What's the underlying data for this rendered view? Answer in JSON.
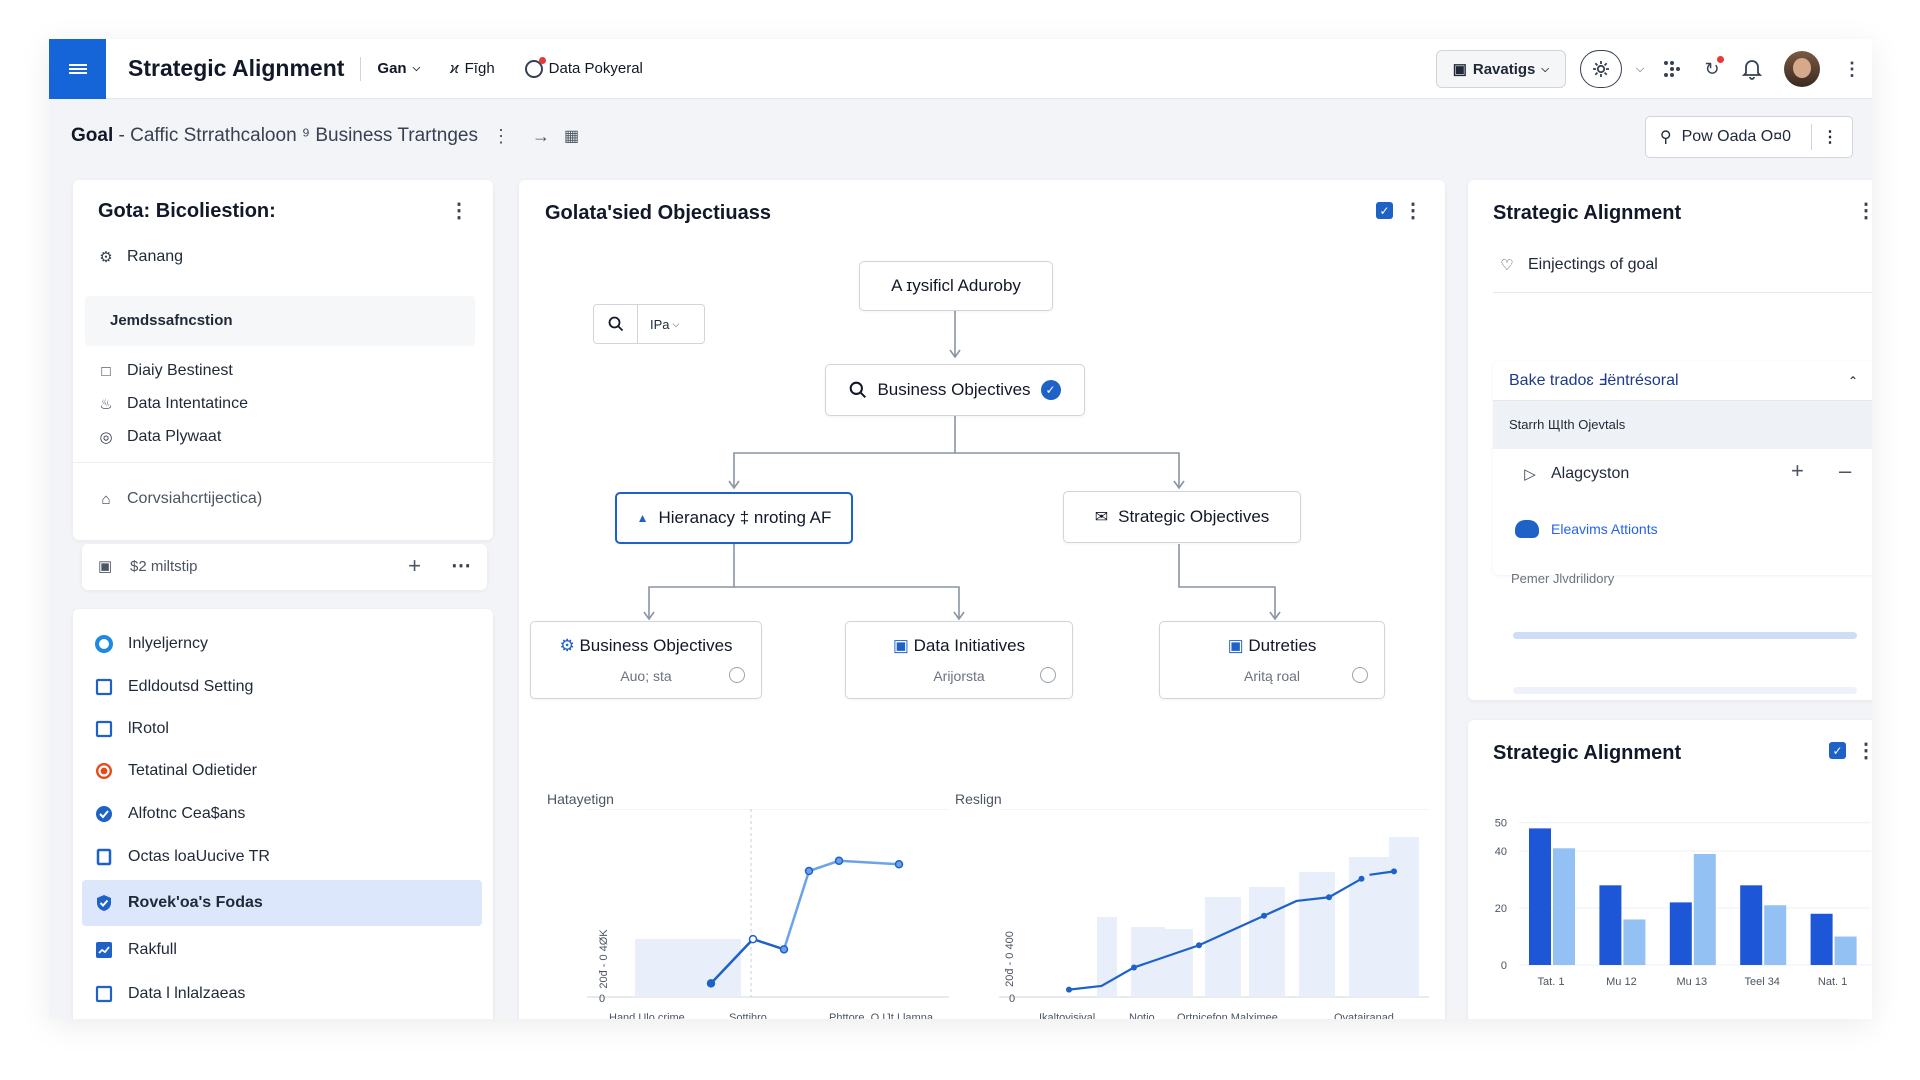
{
  "app": {
    "title": "Strategic Alignment",
    "menu_items": [
      "Gan",
      "Fīgh",
      "Data Pokyeral"
    ],
    "ravatigs_label": "Ravatigs"
  },
  "breadcrumb": {
    "text_bold": "Goal",
    "text_rest": "- Caffic Strrathcaloon ⁹ Business Trartnges",
    "action_button": "Pow Oada O¤0"
  },
  "left_card": {
    "title": "Gota: Bicoliestion:",
    "ranang": "Ranang",
    "section_header": "Jemdssafncstion",
    "items": [
      "Diaiy Bestinest",
      "Data Intentatince",
      "Data Plywaat"
    ],
    "footer_item": "Corvsiahcrtijectica)",
    "field_placeholder": "$2 miltstip"
  },
  "nav_list": [
    {
      "label": "Inlyeljerncy",
      "icon": "ring-icon",
      "color": "#1e88e5"
    },
    {
      "label": "Edldoutsd Setting",
      "icon": "square-icon",
      "color": "#1e62c8"
    },
    {
      "label": "lRotol",
      "icon": "square-icon",
      "color": "#1e62c8"
    },
    {
      "label": "Tetatinal Odietider",
      "icon": "circle-c-icon",
      "color": "#e64a19"
    },
    {
      "label": "Alfotnc Cea$ans",
      "icon": "check-circle-icon",
      "color": "#1e62c8"
    },
    {
      "label": "Octas loaUucive TR",
      "icon": "small-square-icon",
      "color": "#1e62c8"
    },
    {
      "label": "Rovek'oa's Fodas",
      "icon": "shield-icon",
      "color": "#1e62c8"
    },
    {
      "label": "Rakfull",
      "icon": "chart-square-icon",
      "color": "#1e62c8"
    },
    {
      "label": "Data l lnlalzaeas",
      "icon": "square-icon",
      "color": "#1e62c8"
    }
  ],
  "center_card": {
    "title": "Golata'sied Objectiuass",
    "search_filter": "IPa",
    "root_node": "A ɪysificl Aduroby",
    "level1_node": "Business Objectives",
    "level2_left": "Hieranacy ‡ nroting AF",
    "level2_right": "Strategic Objectives",
    "leaves": [
      {
        "title": "Business Objectives",
        "sub": "Auo; sta"
      },
      {
        "title": "Data Initiatives",
        "sub": "Arijorsta"
      },
      {
        "title": "Dutreties",
        "sub": "Aritą roal"
      }
    ]
  },
  "right_card": {
    "title": "Strategic Alignment",
    "goal_label": "Einjectings of goal",
    "accordion_header": "Bake tradoɛ Ⅎëntrésoral",
    "accordion_sub": "Starrh ЩIth Ojevtals",
    "item_label": "Alagcyston",
    "link_label": "Eleavims Attionts",
    "footer_label": "Pemer Jlvdrilidory"
  },
  "chart_data": [
    {
      "type": "line",
      "title": "Hatayetign",
      "ylabel": "20đ - 0 4ØK",
      "y_tick_labels": [
        "0"
      ],
      "x_tick_labels": [
        "Hand Ulo.crime",
        "Sottihro",
        "Phttore, O IJt I lamna"
      ],
      "series": [
        {
          "values": [
            4,
            17,
            14,
            37,
            40,
            39
          ]
        }
      ],
      "colors": [
        "#1e62c8",
        "#6aa3e8"
      ]
    },
    {
      "type": "line",
      "title": "Reslign",
      "ylabel": "20đ - 0 400",
      "y_tick_labels": [
        "0"
      ],
      "x_tick_labels": [
        "Ikaltoyisival",
        "Notio",
        "Ortnicefon Malximee",
        "Ovatairanad"
      ],
      "series": [
        {
          "values": [
            2,
            3,
            8,
            11,
            14,
            18,
            22,
            26,
            27,
            32,
            34
          ]
        }
      ],
      "colors": [
        "#1e62c8"
      ]
    },
    {
      "type": "bar",
      "title": "Strategic Alignment",
      "categories": [
        "Tat. 1",
        "Mu 12",
        "Mu 13",
        "Teel 34",
        "Nat. 1"
      ],
      "series": [
        {
          "values": [
            48,
            28,
            22,
            28,
            18
          ]
        },
        {
          "values": [
            41,
            16,
            39,
            21,
            10
          ]
        }
      ],
      "y_ticks": [
        0,
        20,
        40,
        50
      ],
      "ylim": [
        0,
        52
      ],
      "colors": [
        "#1e56d8",
        "#93c1f3"
      ]
    }
  ]
}
